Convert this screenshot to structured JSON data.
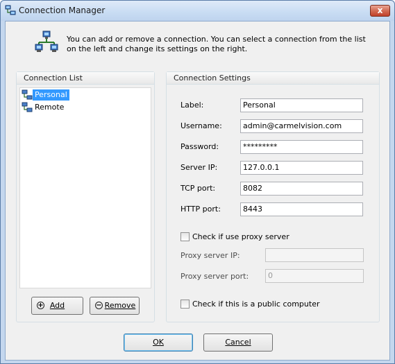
{
  "window": {
    "title": "Connection Manager",
    "close_glyph": "x",
    "title_icon": "network-icon"
  },
  "header": {
    "icon": "network-computers-icon",
    "text": "You can add or remove a connection.  You can select a connection from the list on the left and change its settings on the right."
  },
  "connection_list": {
    "title": "Connection List",
    "items": [
      {
        "label": "Personal",
        "selected": true,
        "icon": "connection-icon"
      },
      {
        "label": "Remote",
        "selected": false,
        "icon": "connection-icon"
      }
    ],
    "add_button": {
      "label": "Add",
      "icon": "add-icon"
    },
    "remove_button": {
      "label": "Remove",
      "icon": "remove-icon"
    }
  },
  "settings": {
    "title": "Connection Settings",
    "fields": {
      "label": {
        "label": "Label:",
        "value": "Personal"
      },
      "username": {
        "label": "Username:",
        "value": "admin@carmelvision.com"
      },
      "password": {
        "label": "Password:",
        "value": "*********"
      },
      "server_ip": {
        "label": "Server IP:",
        "value": "127.0.0.1"
      },
      "tcp_port": {
        "label": "TCP port:",
        "value": "8082"
      },
      "http_port": {
        "label": "HTTP port:",
        "value": "8443"
      }
    },
    "use_proxy": {
      "label": "Check if use proxy server",
      "checked": false
    },
    "proxy_ip": {
      "label": "Proxy server IP:",
      "value": ""
    },
    "proxy_port": {
      "label": "Proxy server port:",
      "value": "0"
    },
    "public_computer": {
      "label": "Check if this is a public computer",
      "checked": false
    }
  },
  "footer": {
    "ok_label": "OK",
    "cancel_label": "Cancel"
  }
}
